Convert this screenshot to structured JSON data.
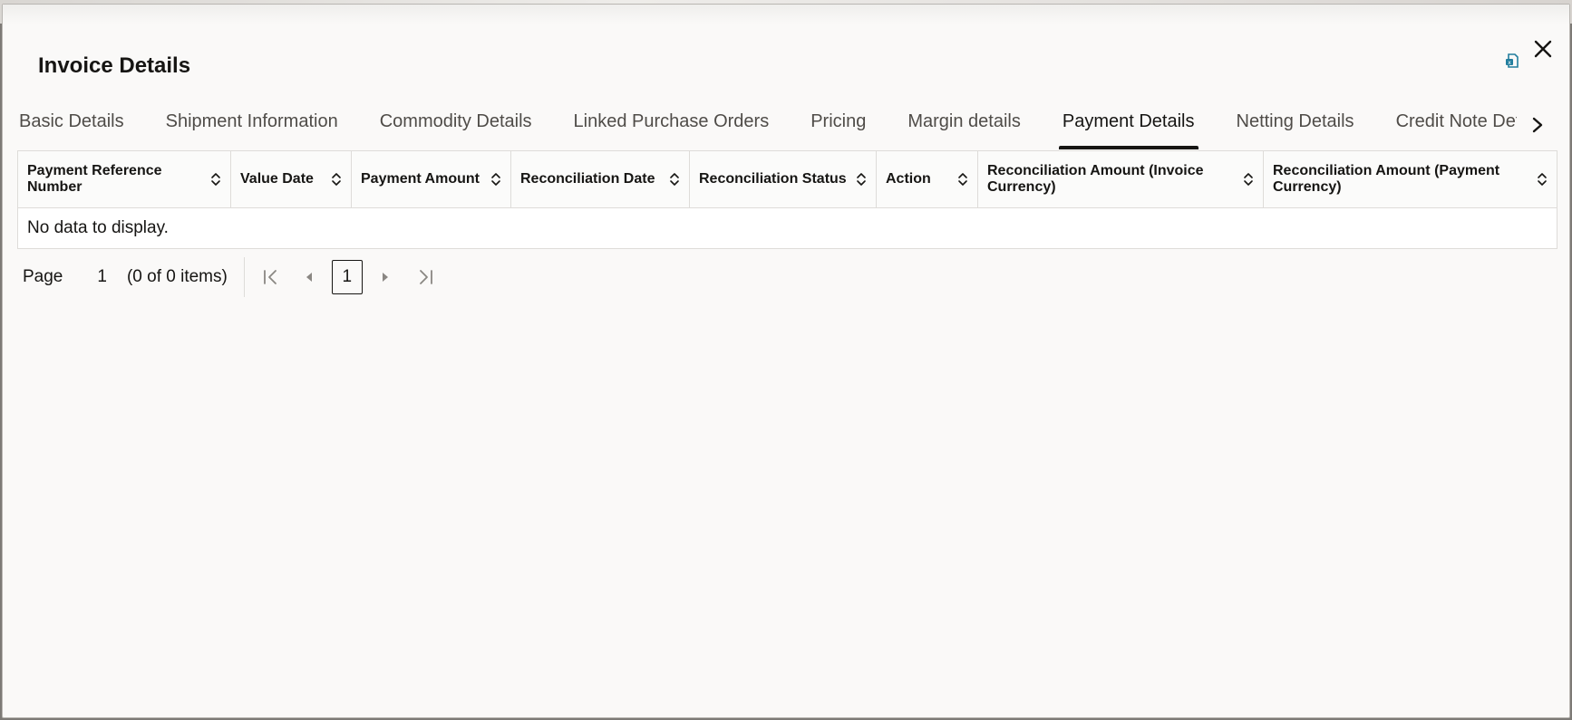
{
  "dialog": {
    "title": "Invoice Details"
  },
  "tabs": [
    {
      "label": "Basic Details"
    },
    {
      "label": "Shipment Information"
    },
    {
      "label": "Commodity Details"
    },
    {
      "label": "Linked Purchase Orders"
    },
    {
      "label": "Pricing"
    },
    {
      "label": "Margin details"
    },
    {
      "label": "Payment Details",
      "active": true
    },
    {
      "label": "Netting Details"
    },
    {
      "label": "Credit Note Det"
    }
  ],
  "table": {
    "columns": [
      {
        "label": "Payment Reference Number"
      },
      {
        "label": "Value Date"
      },
      {
        "label": "Payment Amount"
      },
      {
        "label": "Reconciliation Date"
      },
      {
        "label": "Reconciliation Status"
      },
      {
        "label": "Action"
      },
      {
        "label": "Reconciliation Amount (Invoice Currency)"
      },
      {
        "label": "Reconciliation Amount (Payment Currency)"
      }
    ],
    "empty_message": "No data to display."
  },
  "pagination": {
    "page_label": "Page",
    "page_value": "1",
    "items_text": "(0 of 0 items)",
    "current_page": "1"
  },
  "icons": {
    "export": "export-icon",
    "close": "close-icon",
    "tab_next": "chevron-right-icon",
    "sort": "sort-icon",
    "first": "first-page-icon",
    "prev": "previous-page-icon",
    "next": "next-page-icon",
    "last": "last-page-icon"
  },
  "colors": {
    "text": "#161513",
    "accent_icon": "#227e9e",
    "border": "#dedcd9"
  }
}
